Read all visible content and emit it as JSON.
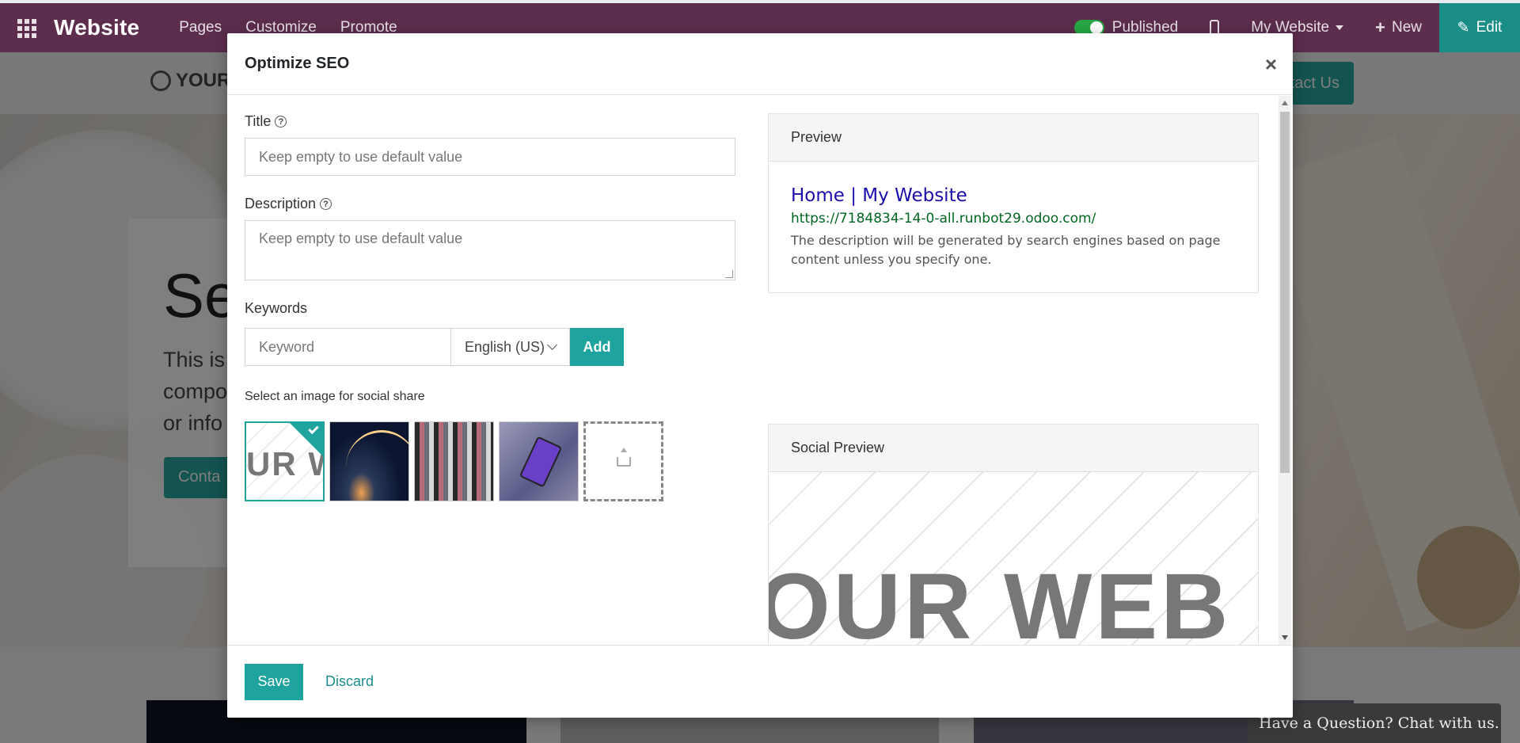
{
  "navbar": {
    "app_name": "Website",
    "menu": [
      "Pages",
      "Customize",
      "Promote"
    ],
    "published_label": "Published",
    "published_on": true,
    "website_selector": "My Website",
    "new_label": "New",
    "edit_label": "Edit"
  },
  "background_site": {
    "logo_text": "YOUR",
    "contact_button": "tact Us",
    "hero_title": "Se",
    "hero_text_lines": [
      "This is",
      "compo",
      "or info"
    ],
    "hero_button": "Conta",
    "chat_label": "Have a Question? Chat with us."
  },
  "modal": {
    "title": "Optimize SEO",
    "close_label": "×",
    "title_field": {
      "label": "Title",
      "placeholder": "Keep empty to use default value",
      "value": ""
    },
    "description_field": {
      "label": "Description",
      "placeholder": "Keep empty to use default value",
      "value": ""
    },
    "keywords": {
      "label": "Keywords",
      "placeholder": "Keyword",
      "language": "English (US)",
      "add_label": "Add"
    },
    "social_image": {
      "label": "Select an image for social share",
      "thumbnail_text": "UR W",
      "selected_index": 0,
      "thumbnails": [
        "logo-watermark",
        "rocket-launch",
        "clothing-rack",
        "smartphone-hand"
      ]
    },
    "preview": {
      "heading": "Preview",
      "page_title": "Home | My Website",
      "url": "https://7184834-14-0-all.runbot29.odoo.com/",
      "description": "The description will be generated by search engines based on page content unless you specify one."
    },
    "social_preview": {
      "heading": "Social Preview",
      "image_text": "OUR WEB"
    },
    "footer": {
      "save_label": "Save",
      "discard_label": "Discard"
    }
  },
  "colors": {
    "navbar": "#5c2d4d",
    "accent": "#1ea39e",
    "edit": "#1b8d87",
    "link_title": "#1a0dab",
    "link_url": "#006621"
  }
}
